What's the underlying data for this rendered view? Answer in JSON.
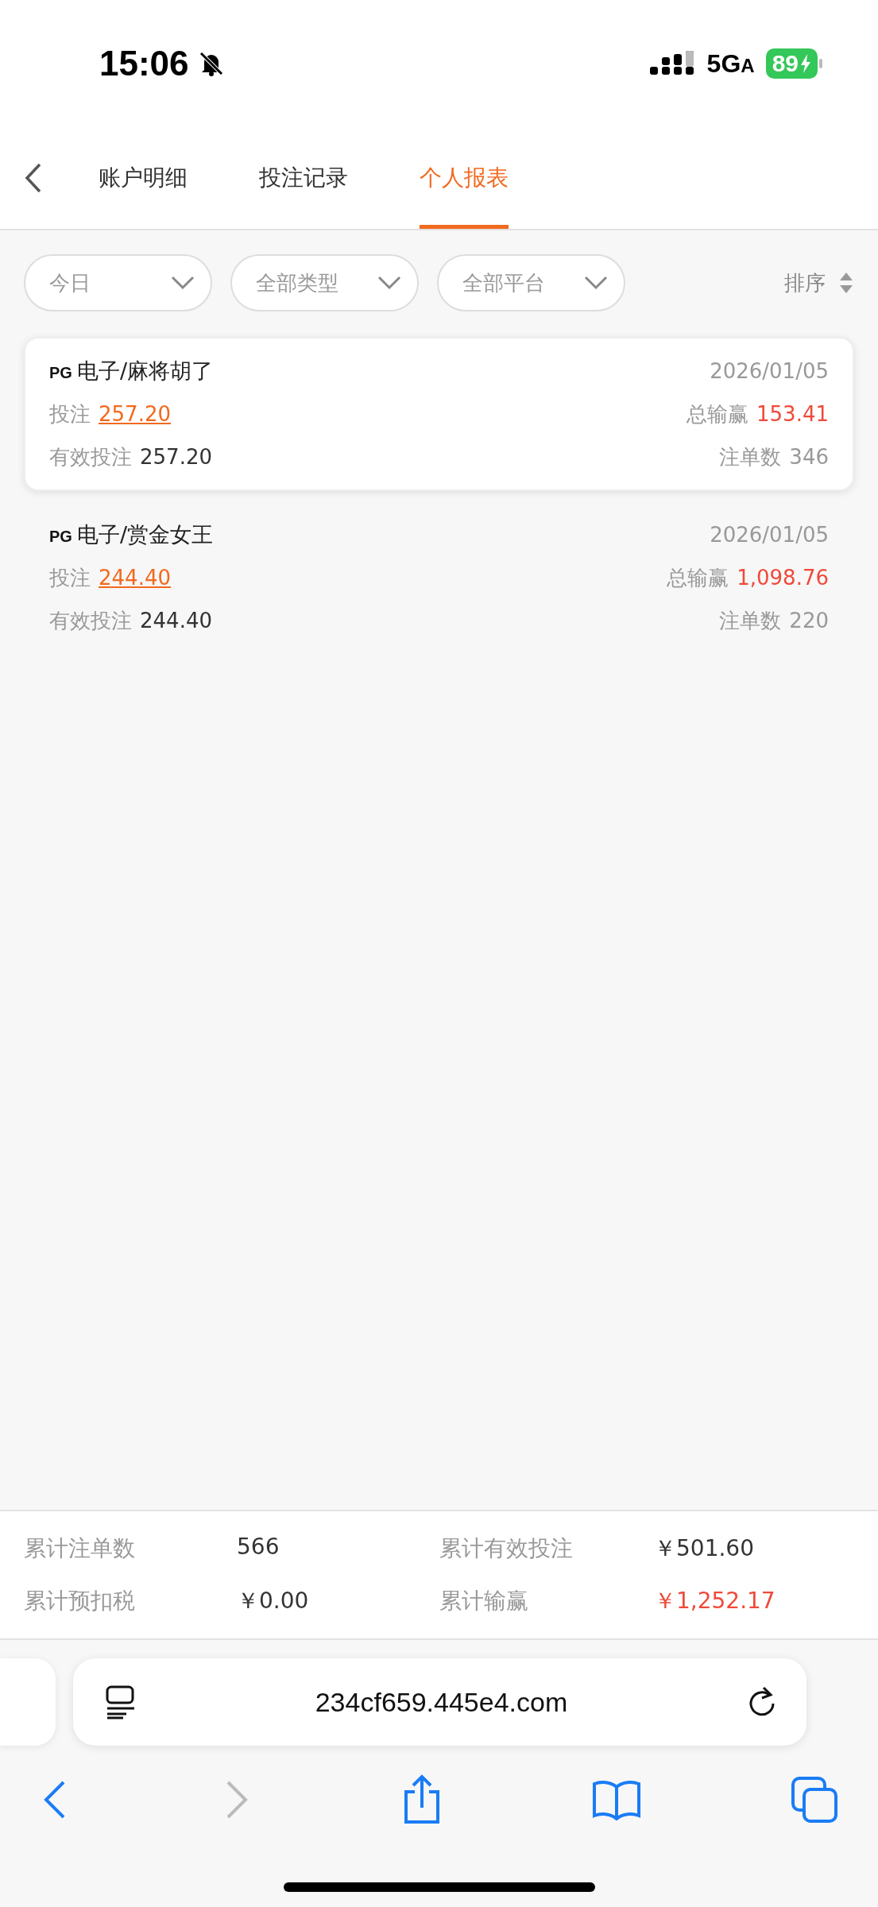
{
  "status_bar": {
    "time": "15:06",
    "network": "5G",
    "network_suffix": "A",
    "battery": "89"
  },
  "tabs": [
    {
      "label": "账户明细",
      "selected": false
    },
    {
      "label": "投注记录",
      "selected": false
    },
    {
      "label": "个人报表",
      "selected": true
    }
  ],
  "filters": [
    "今日",
    "全部类型",
    "全部平台"
  ],
  "sort": {
    "label": "排序"
  },
  "records": [
    {
      "logo": "PG",
      "title": "电子/麻将胡了",
      "date": "2026/01/05",
      "bet_label": "投注",
      "bet": "257.20",
      "win_label": "总输赢",
      "win": "153.41",
      "valid_label": "有效投注",
      "valid": "257.20",
      "count_label": "注单数",
      "count": "346",
      "selected": true
    },
    {
      "logo": "PG",
      "title": "电子/赏金女王",
      "date": "2026/01/05",
      "bet_label": "投注",
      "bet": "244.40",
      "win_label": "总输赢",
      "win": "1,098.76",
      "valid_label": "有效投注",
      "valid": "244.40",
      "count_label": "注单数",
      "count": "220",
      "selected": false
    }
  ],
  "summary": [
    {
      "label": "累计注单数",
      "value": "566",
      "kind": "plain"
    },
    {
      "label": "累计有效投注",
      "value": "￥501.60",
      "kind": "plain"
    },
    {
      "label": "累计预扣税",
      "value": "￥0.00",
      "kind": "plain"
    },
    {
      "label": "累计输赢",
      "value": "￥1,252.17",
      "kind": "win"
    }
  ],
  "browser": {
    "url": "234cf659.445e4.com"
  }
}
